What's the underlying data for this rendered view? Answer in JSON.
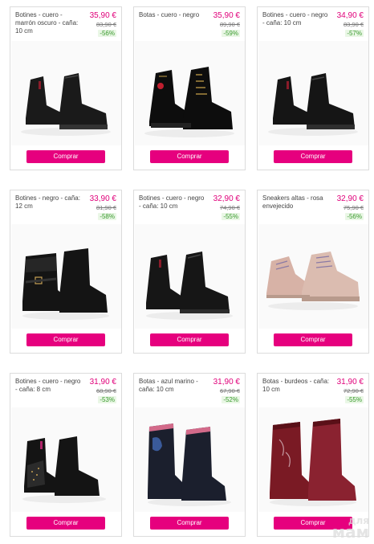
{
  "products": [
    {
      "title": "Botines - cuero - marrón oscuro - caña: 10 cm",
      "price": "35,90 €",
      "old_price": "83,90 €",
      "discount": "-56%",
      "button": "Comprar",
      "color": "#1a1a1a"
    },
    {
      "title": "Botas - cuero - negro",
      "price": "35,90 €",
      "old_price": "89,90 €",
      "discount": "-59%",
      "button": "Comprar",
      "color": "#0d0d0d"
    },
    {
      "title": "Botines - cuero - negro - caña: 10 cm",
      "price": "34,90 €",
      "old_price": "83,90 €",
      "discount": "-57%",
      "button": "Comprar",
      "color": "#151515"
    },
    {
      "title": "Botines - negro - caña: 12 cm",
      "price": "33,90 €",
      "old_price": "81,90 €",
      "discount": "-58%",
      "button": "Comprar",
      "color": "#141414"
    },
    {
      "title": "Botines - cuero - negro - caña: 10 cm",
      "price": "32,90 €",
      "old_price": "74,90 €",
      "discount": "-55%",
      "button": "Comprar",
      "color": "#161616"
    },
    {
      "title": "Sneakers altas - rosa envejecido",
      "price": "32,90 €",
      "old_price": "75,90 €",
      "discount": "-56%",
      "button": "Comprar",
      "color": "#d7b2a6"
    },
    {
      "title": "Botines - cuero - negro - caña: 8 cm",
      "price": "31,90 €",
      "old_price": "68,90 €",
      "discount": "-53%",
      "button": "Comprar",
      "color": "#141414"
    },
    {
      "title": "Botas - azul marino - caña: 10 cm",
      "price": "31,90 €",
      "old_price": "67,90 €",
      "discount": "-52%",
      "button": "Comprar",
      "color": "#1b1f2d"
    },
    {
      "title": "Botas - burdeos - caña: 10 cm",
      "price": "31,90 €",
      "old_price": "72,90 €",
      "discount": "-55%",
      "button": "Comprar",
      "color": "#7a1a24"
    }
  ],
  "watermark": {
    "line1": "для",
    "line2": "мам"
  },
  "colors": {
    "accent": "#e6007e",
    "price": "#e0007a",
    "discount_text": "#3a9a2e",
    "discount_bg": "#eaf7e6"
  }
}
